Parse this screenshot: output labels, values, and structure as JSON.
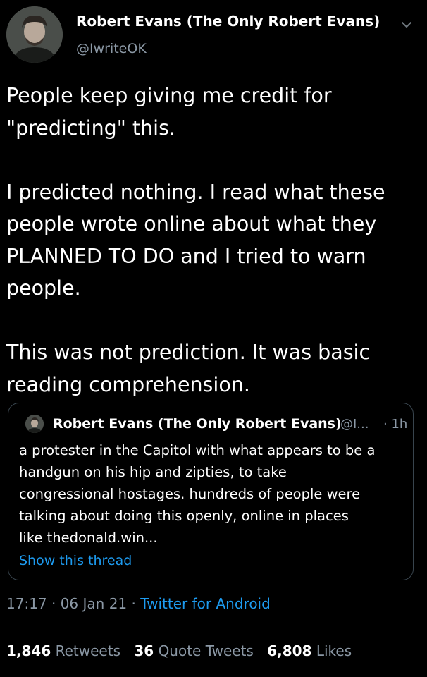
{
  "author": {
    "name": "Robert Evans (The Only Robert Evans)",
    "handle": "@IwriteOK",
    "avatar_icon": "profile-photo"
  },
  "menu_icon": "chevron-down-icon",
  "tweet": {
    "lines": [
      "People keep giving me credit for",
      "\"predicting\" this.",
      "",
      "I predicted nothing. I read what these",
      "people wrote online about what they",
      "PLANNED TO DO and I tried to warn",
      "people.",
      "",
      "This was not prediction. It was basic",
      "reading comprehension."
    ]
  },
  "quoted_tweet": {
    "author_name": "Robert Evans (The Only Robert Evans)",
    "author_handle": "@I...",
    "time": "· 1h",
    "body_lines": [
      "a protester in the Capitol with what appears to be a",
      "handgun on his hip and zipties, to take",
      "congressional hostages. hundreds of people were",
      "talking about doing this openly, online in places",
      "like thedonald.win..."
    ],
    "show_thread_label": "Show this thread"
  },
  "meta": {
    "time_date": "17:17 · 06 Jan 21 · ",
    "source": "Twitter for Android"
  },
  "stats": {
    "retweets_count": "1,846",
    "retweets_label": "Retweets",
    "quotes_count": "36",
    "quotes_label": "Quote Tweets",
    "likes_count": "6,808",
    "likes_label": "Likes"
  },
  "colors": {
    "background": "#000000",
    "text": "#ffffff",
    "secondary": "#8b98a5",
    "link": "#1d9bf0",
    "border": "#38444d"
  }
}
